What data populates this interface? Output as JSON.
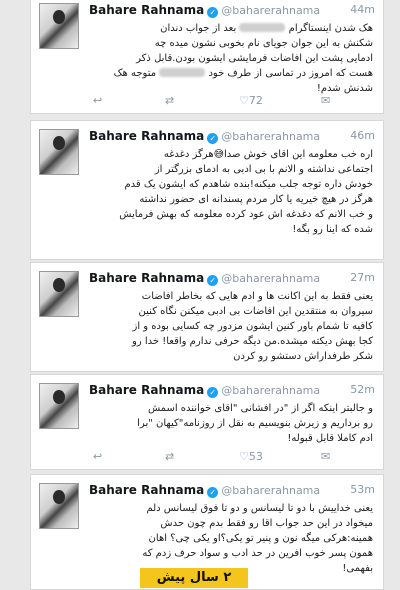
{
  "tweets": [
    {
      "name": "Bahare Rahnama",
      "handle": "@baharerahnama",
      "time": "44m",
      "lines": [
        "هک شدن اینستاگرام [blurred] بعد از جواب دندان",
        "شکنش به این جوان جویای نام بخوبی نشون میده چه",
        "ادمایی پشت این افاضات فرمایشی ایشون بودن.قابل ذکر",
        "هست که امروز در تماسی از طرف خود [blurred] متوجه هک",
        "شدنش شدم!"
      ],
      "retweets": "",
      "likes": "72"
    },
    {
      "name": "Bahare Rahnama",
      "handle": "@baharerahnama",
      "time": "46m",
      "lines": [
        "اره خب معلومه این اقای خوش صدا😅هرگز دغدغه",
        "اجتماعی نداشته و الانم با بی ادبی به ادمای بزرگتر از",
        "خودش داره توجه جلب میکنه!بنده شاهدم که ایشون یک قدم",
        "هرگز در هیچ خیریه یا کار مردم پسندانه ای حضور نداشته",
        "و خب الانم که دغدغه اش عود کرده معلومه که بهش فرمایش",
        "شده که اینا رو بگه!"
      ],
      "retweets": "",
      "likes": ""
    },
    {
      "name": "Bahare Rahnama",
      "handle": "@baharerahnama",
      "time": "27m",
      "lines": [
        "یعنی فقط به این اکانت ها و ادم هایی که بخاطر افاضات",
        "سیروان به منتقدین این افاضات بی ادبی میکنن نگاه کنین",
        "کافیه تا شمام باور کنین ایشون مزدور چه کسایی بوده و از",
        "کجا بهش دیکته میشده.من دیگه حرفی ندارم واقعا! خدا رو",
        "شکر طرفداراش دستشو رو کردن"
      ],
      "retweets": "",
      "likes": ""
    },
    {
      "name": "Bahare Rahnama",
      "handle": "@baharerahnama",
      "time": "52m",
      "lines": [
        "و جالبتر اینکه اگر از \"در افشانی \"اقای خواننده اسمش",
        "رو برداریم و زیرش بنویسیم به نقل از روزنامه\"کیهان \"برا",
        "ادم کاملا قابل قبوله!"
      ],
      "retweets": "",
      "likes": "53"
    },
    {
      "name": "Bahare Rahnama",
      "handle": "@baharerahnama",
      "time": "53m",
      "lines": [
        "یعنی خداییش با دو تا لیسانس و دو تا فوق لیسانس دلم",
        "میخواد در این حد جواب اقا رو فقط بدم چون حدش",
        "همینه:هرکی میگه نون و پنیر تو یکی؟او یکی چی؟ اهان",
        "همون پسر خوب افرین در حد ادب و سواد حرف زدم که",
        "بفهمی!"
      ],
      "retweets": "",
      "likes": ""
    }
  ],
  "banner_text": "۲ سال پیش",
  "icons": {
    "reply": "reply-icon",
    "retweet": "retweet-icon",
    "like": "heart-icon",
    "message": "message-icon",
    "verified": "verified-badge-icon"
  },
  "colors": {
    "accent": "#1da1f2",
    "muted": "#8899a6",
    "banner": "#f4c51c"
  }
}
